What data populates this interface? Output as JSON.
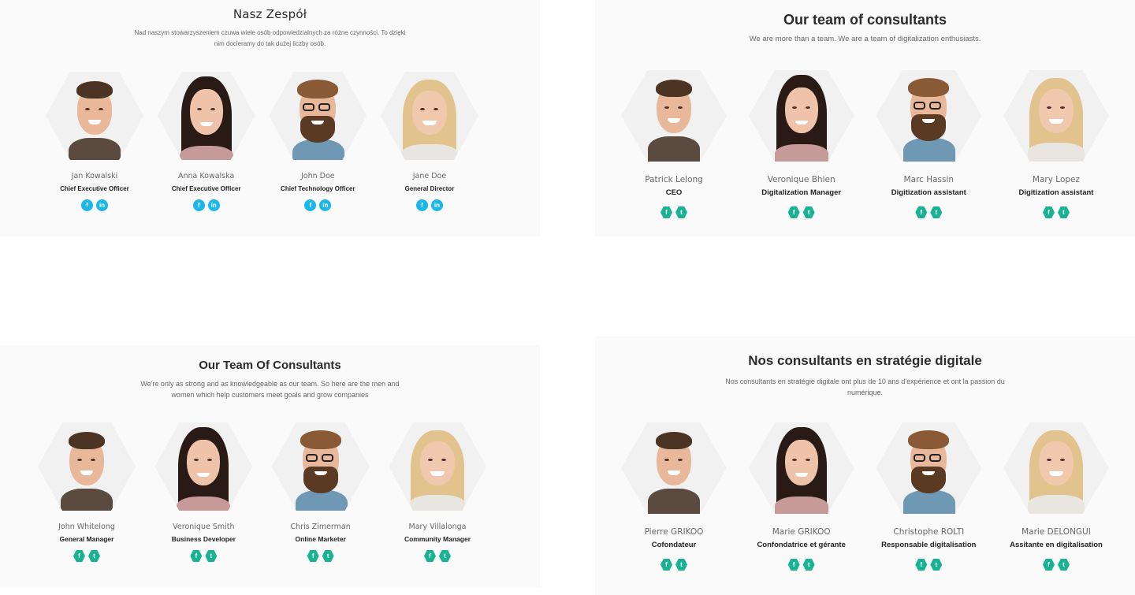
{
  "colors": {
    "panel_bg": "#fafafa",
    "cyan_social": "#1ab7ea",
    "teal_social": "#19b394"
  },
  "sections": [
    {
      "title": "Nasz Zespół",
      "subtitle": "Nad naszym stowarzyszeniem czuwa wiele osób odpowiedzialnych za różne czynności. To dzięki nim docieramy do tak dużej liczby osób.",
      "social_icons": [
        "facebook-icon",
        "linkedin-icon"
      ],
      "social_glyphs": [
        "f",
        "in"
      ],
      "members": [
        {
          "name": "Jan Kowalski",
          "role": "Chief Executive Officer"
        },
        {
          "name": "Anna Kowalska",
          "role": "Chief Executive Officer"
        },
        {
          "name": "John Doe",
          "role": "Chief Technology Officer"
        },
        {
          "name": "Jane Doe",
          "role": "General Director"
        }
      ]
    },
    {
      "title": "Our team of consultants",
      "subtitle": "We are more than a team. We are a team of digitalization enthusiasts.",
      "social_icons": [
        "facebook-icon",
        "twitter-icon"
      ],
      "social_glyphs": [
        "f",
        "t"
      ],
      "members": [
        {
          "name": "Patrick Lelong",
          "role": "CEO"
        },
        {
          "name": "Veronique Bhien",
          "role": "Digitalization Manager"
        },
        {
          "name": "Marc Hassin",
          "role": "Digitization assistant"
        },
        {
          "name": "Mary Lopez",
          "role": "Digitization assistant"
        }
      ]
    },
    {
      "title": "Our Team Of Consultants",
      "subtitle": "We're only as strong and as knowledgeable as our team. So here are the men and women which help customers meet goals and grow companies",
      "social_icons": [
        "facebook-icon",
        "twitter-icon"
      ],
      "social_glyphs": [
        "f",
        "t"
      ],
      "members": [
        {
          "name": "John Whitelong",
          "role": "General Manager"
        },
        {
          "name": "Veronique Smith",
          "role": "Business Developer"
        },
        {
          "name": "Chris Zimerman",
          "role": "Online Marketer"
        },
        {
          "name": "Mary Villalonga",
          "role": "Community Manager"
        }
      ]
    },
    {
      "title": "Nos consultants en stratégie digitale",
      "subtitle": "Nos consultants en stratégie digitale ont plus de 10 ans d'expérience et ont la passion du numérique.",
      "social_icons": [
        "facebook-icon",
        "twitter-icon"
      ],
      "social_glyphs": [
        "f",
        "t"
      ],
      "members": [
        {
          "name": "Pierre GRIKOO",
          "role": "Cofondateur"
        },
        {
          "name": "Marie GRIKOO",
          "role": "Confondatrice et gérante"
        },
        {
          "name": "Christophe ROLTI",
          "role": "Responsable digitalisation"
        },
        {
          "name": "Marie DELONGUI",
          "role": "Assitante en digitalisation"
        }
      ]
    }
  ]
}
